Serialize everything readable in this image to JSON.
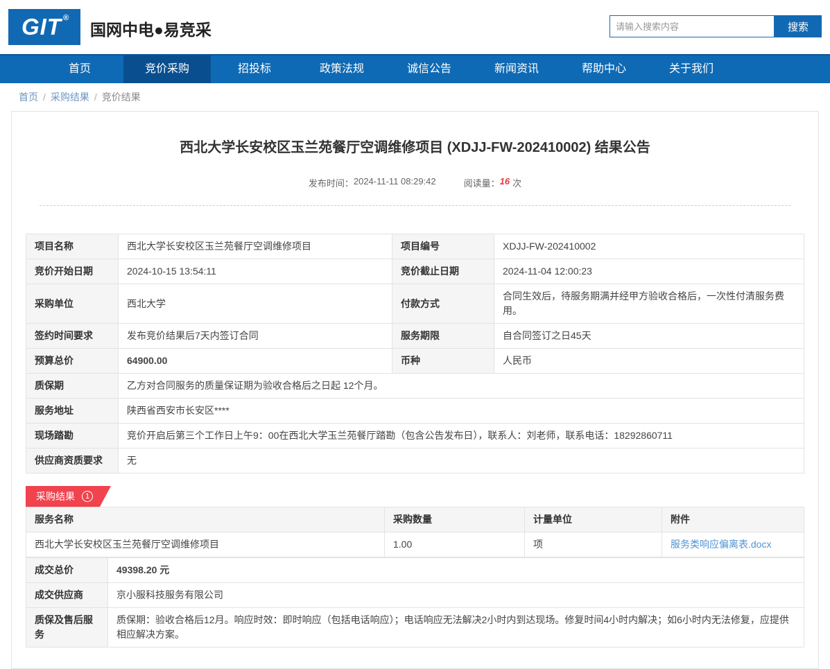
{
  "colors": {
    "brand_blue": "#1269b3",
    "nav_blue": "#0f6ab5",
    "nav_active_blue": "#094f90",
    "price_red": "#e8393f",
    "badge_red": "#f0434e",
    "attachment_link_blue": "#4f93d6"
  },
  "header": {
    "logo_text": "GIT",
    "logo_registered": "®",
    "site_name": "国网中电●易竞采",
    "search": {
      "placeholder": "请输入搜索内容",
      "button": "搜索"
    }
  },
  "nav": {
    "items": [
      {
        "label": "首页",
        "active": false
      },
      {
        "label": "竞价采购",
        "active": true
      },
      {
        "label": "招投标",
        "active": false
      },
      {
        "label": "政策法规",
        "active": false
      },
      {
        "label": "诚信公告",
        "active": false
      },
      {
        "label": "新闻资讯",
        "active": false
      },
      {
        "label": "帮助中心",
        "active": false
      },
      {
        "label": "关于我们",
        "active": false
      }
    ]
  },
  "breadcrumb": {
    "separator": "/",
    "items": [
      {
        "label": "首页",
        "link": true
      },
      {
        "label": "采购结果",
        "link": true
      },
      {
        "label": "竞价结果",
        "link": false
      }
    ]
  },
  "announcement": {
    "title": "西北大学长安校区玉兰苑餐厅空调维修项目 (XDJJ-FW-202410002) 结果公告",
    "publish_time_label": "发布时间：",
    "publish_time": "2024-11-11 08:29:42",
    "views_label": "阅读量：",
    "views_count": "16",
    "views_unit": "次"
  },
  "project_info": {
    "rows": [
      {
        "type": "pair",
        "label1": "项目名称",
        "value1": "西北大学长安校区玉兰苑餐厅空调维修项目",
        "label2": "项目编号",
        "value2": "XDJJ-FW-202410002"
      },
      {
        "type": "pair",
        "label1": "竞价开始日期",
        "value1": "2024-10-15 13:54:11",
        "label2": "竞价截止日期",
        "value2": "2024-11-04 12:00:23"
      },
      {
        "type": "pair",
        "label1": "采购单位",
        "value1": "西北大学",
        "label2": "付款方式",
        "value2": "合同生效后，待服务期满并经甲方验收合格后，一次性付清服务费用。"
      },
      {
        "type": "pair",
        "label1": "签约时间要求",
        "value1": "发布竞价结果后7天内签订合同",
        "label2": "服务期限",
        "value2": "自合同签订之日45天"
      },
      {
        "type": "pair",
        "label1": "预算总价",
        "value1": "64900.00",
        "value1_highlight": true,
        "label2": "币种",
        "value2": "人民币"
      },
      {
        "type": "full",
        "label": "质保期",
        "value": "乙方对合同服务的质量保证期为验收合格后之日起 12个月。"
      },
      {
        "type": "full",
        "label": "服务地址",
        "value": "陕西省西安市长安区****"
      },
      {
        "type": "full",
        "label": "现场踏勘",
        "value": "竞价开启后第三个工作日上午9：00在西北大学玉兰苑餐厅踏勘（包含公告发布日），联系人：刘老师，联系电话：18292860711"
      },
      {
        "type": "full",
        "label": "供应商资质要求",
        "value": "无"
      }
    ]
  },
  "result_section": {
    "badge_label": "采购结果",
    "badge_count": "1",
    "table": {
      "headers": [
        "服务名称",
        "采购数量",
        "计量单位",
        "附件"
      ],
      "rows": [
        {
          "service_name": "西北大学长安校区玉兰苑餐厅空调维修项目",
          "quantity": "1.00",
          "unit": "项",
          "attachment": "服务类响应偏离表.docx"
        }
      ]
    },
    "summary_rows": [
      {
        "label": "成交总价",
        "value": "49398.20 元",
        "highlight": true
      },
      {
        "label": "成交供应商",
        "value": "京小服科技服务有限公司",
        "highlight": false
      },
      {
        "label": "质保及售后服务",
        "value": "质保期：验收合格后12月。响应时效：即时响应（包括电话响应）；电话响应无法解决2小时内到达现场。修复时间4小时内解决；如6小时内无法修复，应提供相应解决方案。",
        "highlight": false
      }
    ]
  }
}
